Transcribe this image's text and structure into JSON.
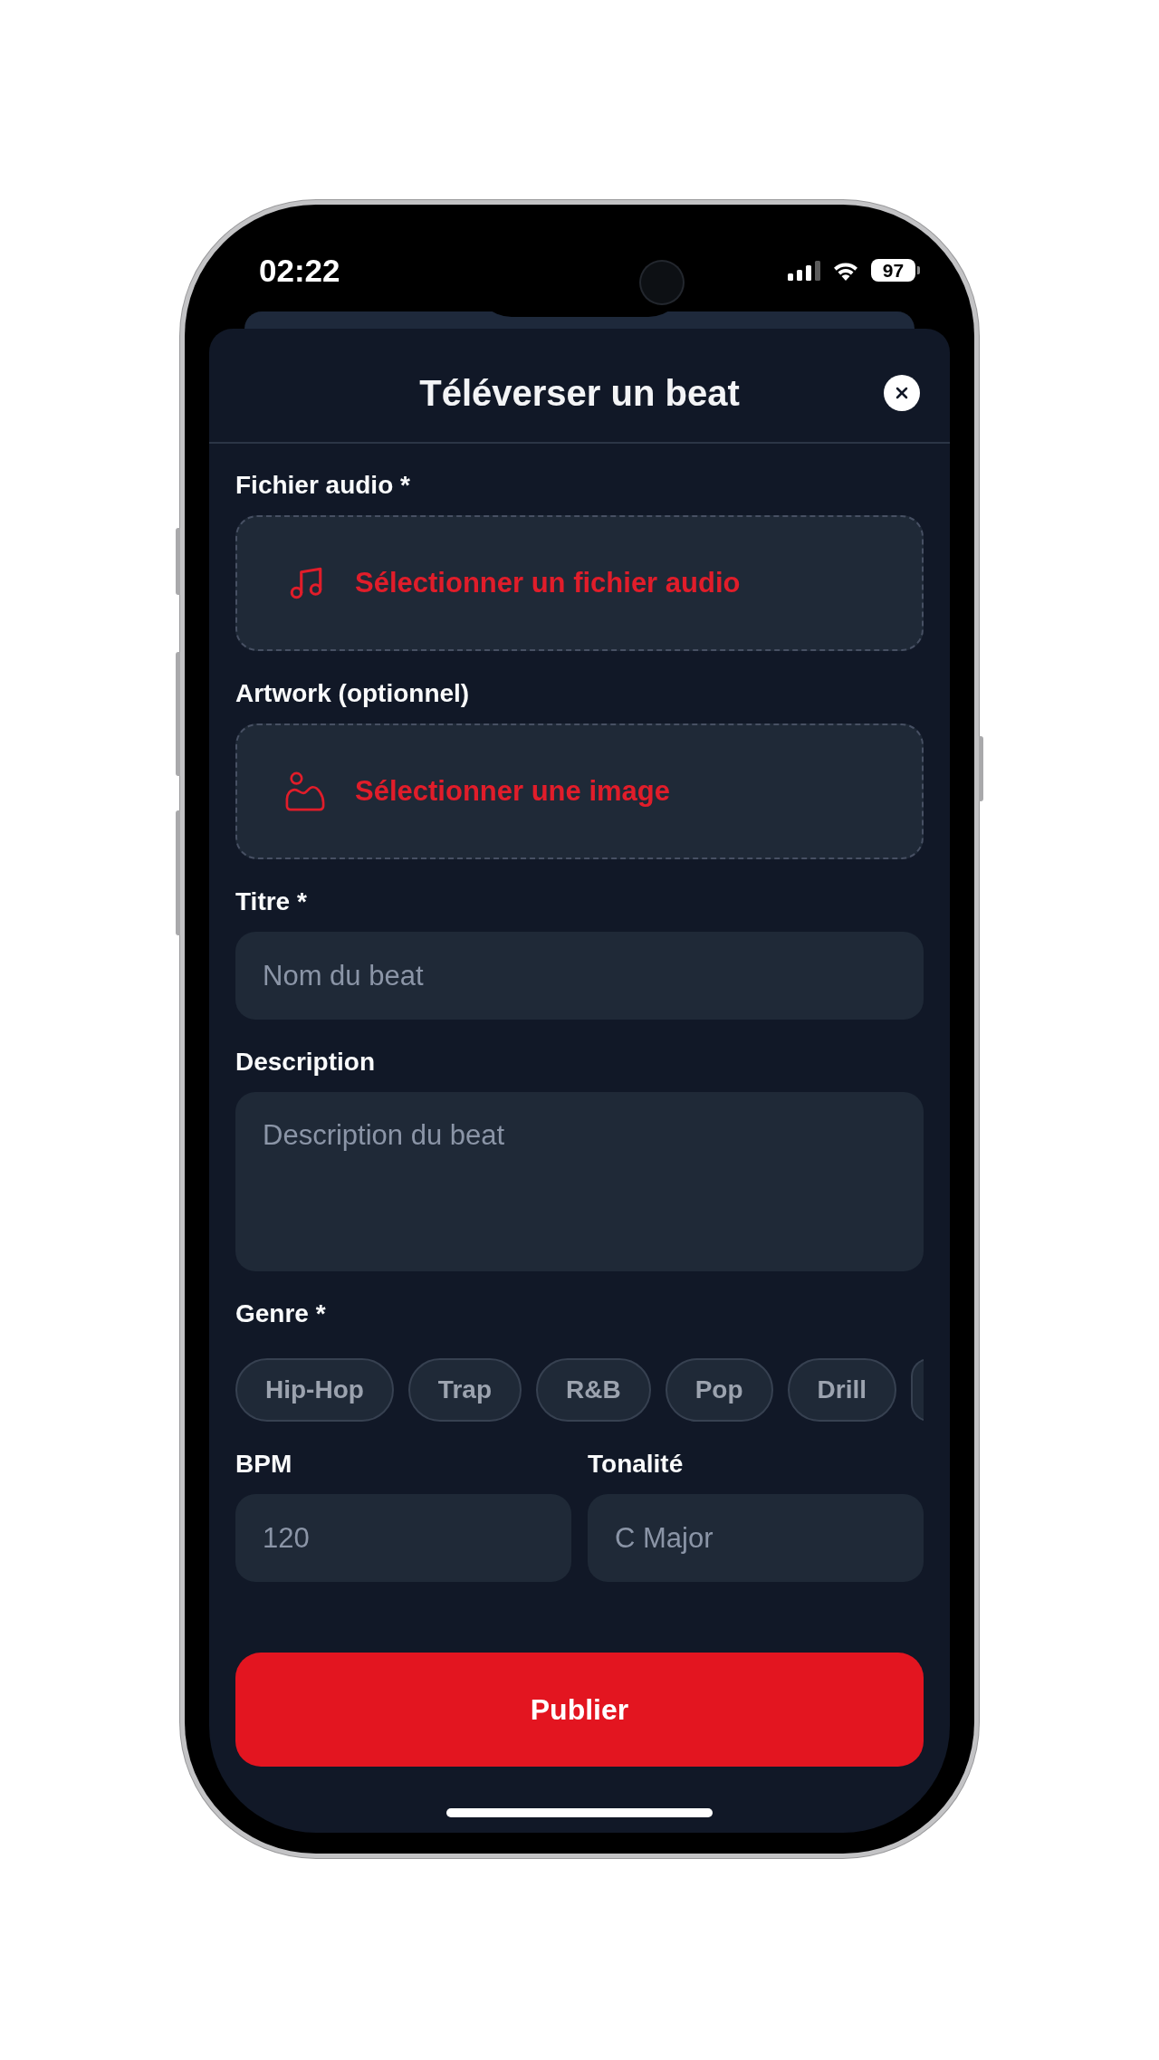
{
  "status_bar": {
    "time": "02:22",
    "battery": "97"
  },
  "header": {
    "title": "Téléverser un beat"
  },
  "audio_file": {
    "label": "Fichier audio *",
    "button": "Sélectionner un fichier audio"
  },
  "artwork": {
    "label": "Artwork (optionnel)",
    "button": "Sélectionner une image"
  },
  "title_field": {
    "label": "Titre *",
    "placeholder": "Nom du beat"
  },
  "description": {
    "label": "Description",
    "placeholder": "Description du beat"
  },
  "genre": {
    "label": "Genre *",
    "options": [
      {
        "label": "Hip-Hop",
        "selected": false
      },
      {
        "label": "Trap",
        "selected": false
      },
      {
        "label": "R&B",
        "selected": false
      },
      {
        "label": "Pop",
        "selected": false
      },
      {
        "label": "Drill",
        "selected": false
      }
    ]
  },
  "bpm": {
    "label": "BPM",
    "placeholder": "120"
  },
  "key": {
    "label": "Tonalité",
    "placeholder": "C Major"
  },
  "publish_button": "Publier"
}
